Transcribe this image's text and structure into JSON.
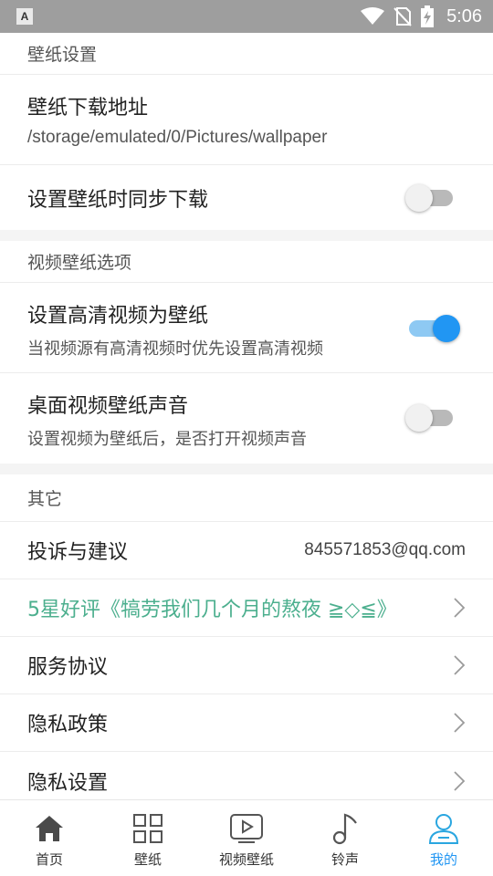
{
  "status_bar": {
    "app_badge": "A",
    "time": "5:06"
  },
  "wallpaper_settings": {
    "section_title": "壁纸设置",
    "download_path_title": "壁纸下载地址",
    "download_path_value": "/storage/emulated/0/Pictures/wallpaper",
    "sync_download_title": "设置壁纸时同步下载",
    "sync_download_enabled": false
  },
  "video_options": {
    "section_title": "视频壁纸选项",
    "hd_title": "设置高清视频为壁纸",
    "hd_sub": "当视频源有高清视频时优先设置高清视频",
    "hd_enabled": true,
    "sound_title": "桌面视频壁纸声音",
    "sound_sub": "设置视频为壁纸后，是否打开视频声音",
    "sound_enabled": false
  },
  "other": {
    "section_title": "其它",
    "feedback_title": "投诉与建议",
    "feedback_email": "845571853@qq.com",
    "rate_title": "5星好评《犒劳我们几个月的熬夜 ≧◇≦》",
    "service_title": "服务协议",
    "privacy_policy_title": "隐私政策",
    "privacy_settings_title": "隐私设置"
  },
  "nav": {
    "items": [
      {
        "label": "首页",
        "icon": "home-icon"
      },
      {
        "label": "壁纸",
        "icon": "grid-icon"
      },
      {
        "label": "视频壁纸",
        "icon": "video-icon"
      },
      {
        "label": "铃声",
        "icon": "music-note-icon"
      },
      {
        "label": "我的",
        "icon": "person-icon"
      }
    ],
    "active_index": 4
  },
  "colors": {
    "accent": "#2196f3",
    "rate_text": "#4caf8e",
    "status_bar": "#9e9e9e"
  }
}
